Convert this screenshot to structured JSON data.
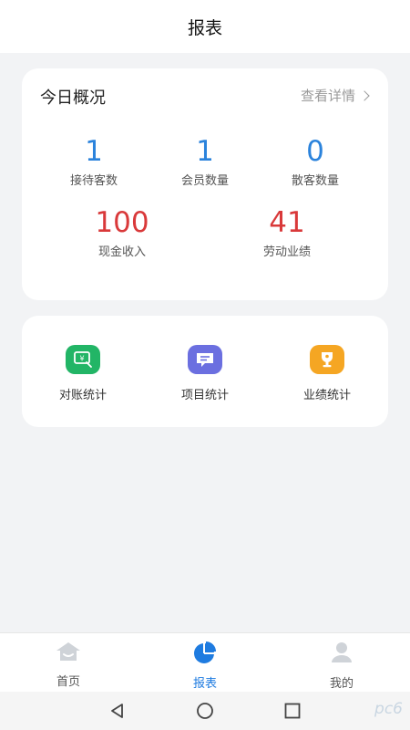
{
  "header": {
    "title": "报表"
  },
  "overview": {
    "title": "今日概况",
    "detail_link": "查看详情",
    "stats_row1": [
      {
        "value": "1",
        "label": "接待客数"
      },
      {
        "value": "1",
        "label": "会员数量"
      },
      {
        "value": "0",
        "label": "散客数量"
      }
    ],
    "stats_row2": [
      {
        "value": "100",
        "label": "现金收入"
      },
      {
        "value": "41",
        "label": "劳动业绩"
      }
    ]
  },
  "shortcuts": [
    {
      "label": "对账统计",
      "icon": "reconcile-icon",
      "color": "#22b566"
    },
    {
      "label": "项目统计",
      "icon": "project-message-icon",
      "color": "#6b6fe0"
    },
    {
      "label": "业绩统计",
      "icon": "trophy-icon",
      "color": "#f5a623"
    }
  ],
  "tabbar": [
    {
      "label": "首页",
      "icon": "home-icon"
    },
    {
      "label": "报表",
      "icon": "pie-chart-icon",
      "active": true
    },
    {
      "label": "我的",
      "icon": "user-icon"
    }
  ],
  "colors": {
    "accent": "#1e7be0",
    "stat_blue": "#2b83dc",
    "stat_red": "#d9393a"
  },
  "watermark": "pc6"
}
